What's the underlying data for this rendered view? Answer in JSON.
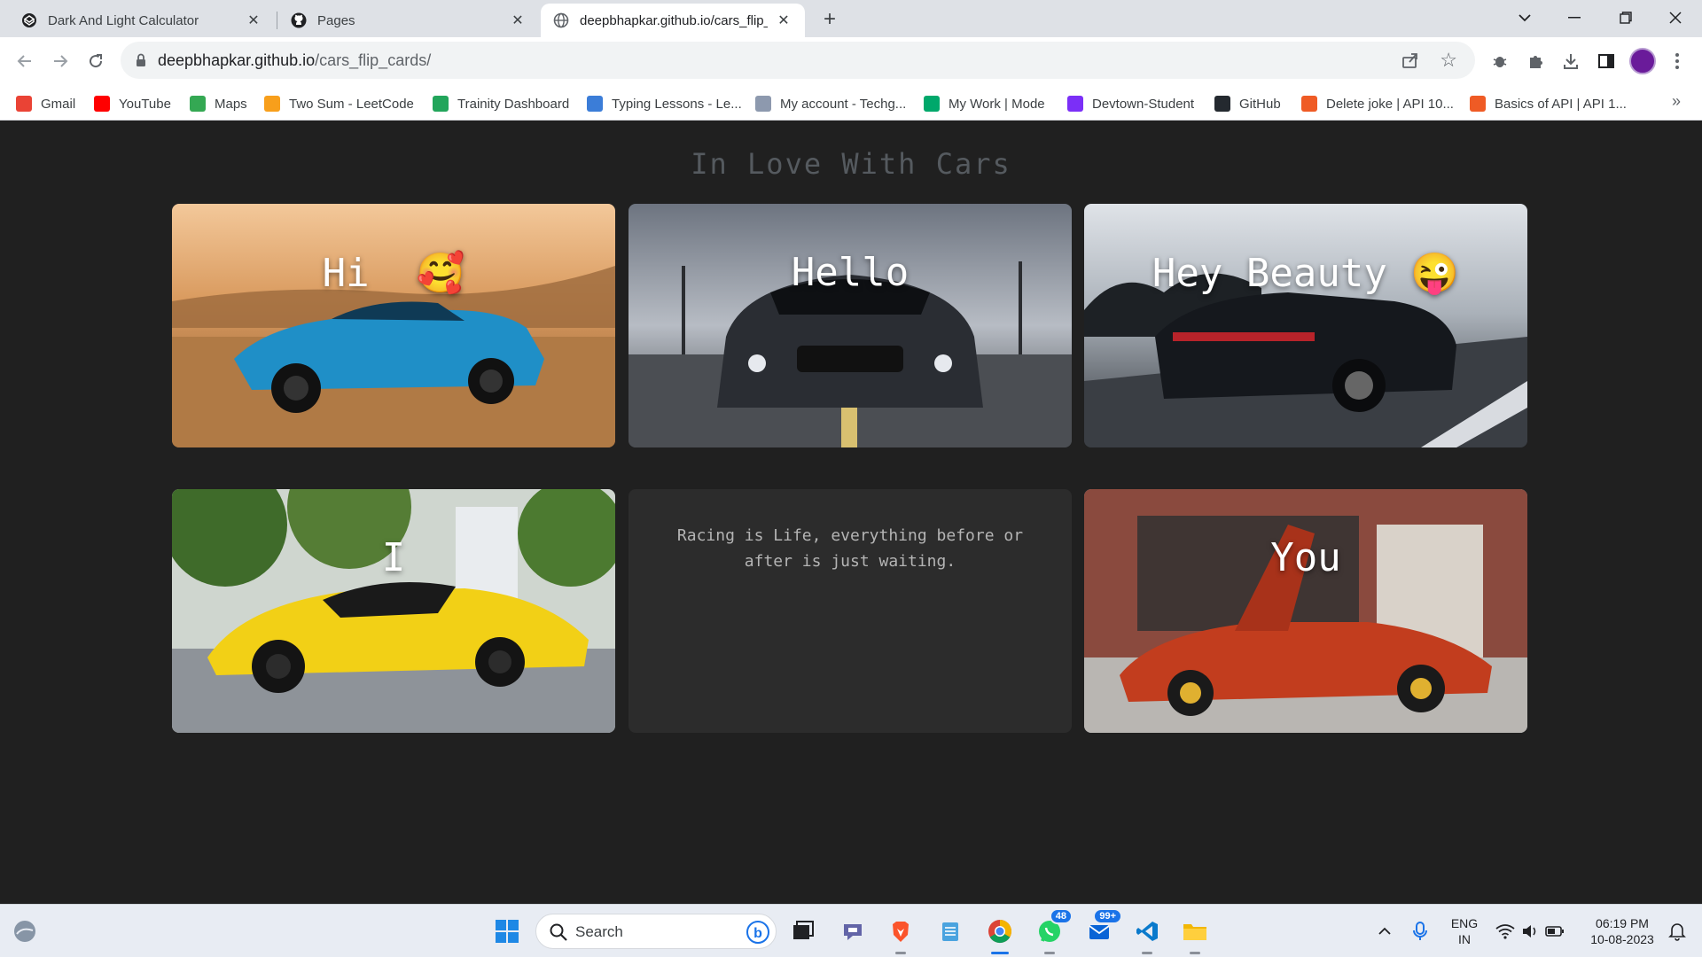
{
  "browser": {
    "tabs": [
      {
        "title": "Dark And Light Calculator",
        "icon": "codepen-icon"
      },
      {
        "title": "Pages",
        "icon": "github-icon"
      },
      {
        "title": "deepbhapkar.github.io/cars_flip_",
        "icon": "globe-icon",
        "active": true
      }
    ],
    "url_host": "deepbhapkar.github.io",
    "url_path": "/cars_flip_cards/",
    "bookmarks": [
      {
        "label": "Gmail",
        "icon": "gmail-icon",
        "color": "#ea4335"
      },
      {
        "label": "YouTube",
        "icon": "youtube-icon",
        "color": "#ff0000"
      },
      {
        "label": "Maps",
        "icon": "maps-icon",
        "color": "#34a853"
      },
      {
        "label": "Two Sum - LeetCode",
        "icon": "leetcode-icon",
        "color": "#f89f1b"
      },
      {
        "label": "Trainity Dashboard",
        "icon": "trainity-icon",
        "color": "#22a55b"
      },
      {
        "label": "Typing Lessons - Le...",
        "icon": "typing-icon",
        "color": "#3b7dd8"
      },
      {
        "label": "My account - Techg...",
        "icon": "techgig-icon",
        "color": "#8d99ae"
      },
      {
        "label": "My Work | Mode",
        "icon": "monday-icon",
        "color": "#00a86b"
      },
      {
        "label": "Devtown-Student",
        "icon": "devtown-icon",
        "color": "#7b2ff7"
      },
      {
        "label": "GitHub",
        "icon": "github-icon",
        "color": "#24292f"
      },
      {
        "label": "Delete joke | API 10...",
        "icon": "postman-icon",
        "color": "#ef5b25"
      },
      {
        "label": "Basics of API | API 1...",
        "icon": "postman-icon",
        "color": "#ef5b25"
      }
    ]
  },
  "page": {
    "title": "In Love With Cars",
    "cards": [
      {
        "caption": "Hi  🥰",
        "car_color": "#1f8fc7",
        "scene": "desert"
      },
      {
        "caption": "Hello",
        "car_color": "#2a2d33",
        "scene": "parking"
      },
      {
        "caption": "Hey Beauty 😜",
        "car_color": "#15181d",
        "scene": "road"
      },
      {
        "caption": "I",
        "car_color": "#f2d016",
        "scene": "trees"
      },
      {
        "quote": "Racing is Life, everything before or after is just waiting."
      },
      {
        "caption": "You",
        "car_color": "#c23d1e",
        "scene": "shop"
      }
    ]
  },
  "taskbar": {
    "search_label": "Search",
    "whatsapp_badge": "48",
    "mail_badge": "99+",
    "lang_top": "ENG",
    "lang_bottom": "IN",
    "time": "06:19 PM",
    "date": "10-08-2023"
  }
}
